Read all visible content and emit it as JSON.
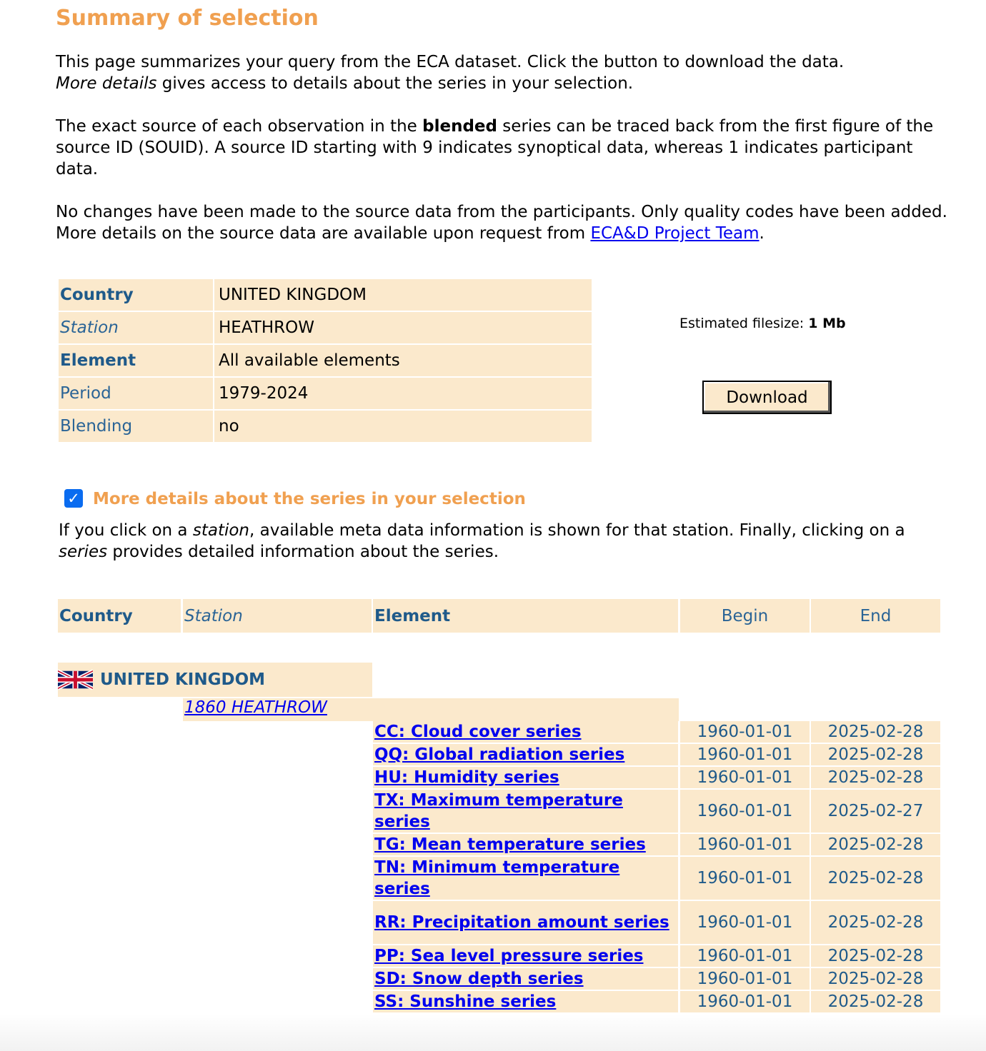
{
  "page": {
    "title": "Summary of selection"
  },
  "intro": {
    "p1_a": "This page summarizes your query from the ECA dataset. Click the button to download the data.",
    "p1_b_italic": "More details",
    "p1_b_rest": " gives access to details about the series in your selection.",
    "p2_a": "The exact source of each observation in the ",
    "p2_bold": "blended",
    "p2_b": " series can be traced back from the first figure of the source ID (SOUID). A source ID starting with 9 indicates synoptical data, whereas 1 indicates participant data.",
    "p3_a": "No changes have been made to the source data from the participants. Only quality codes have been added. More details on the source data are available upon request from ",
    "p3_link": "ECA&D Project Team",
    "p3_end": "."
  },
  "summary": {
    "rows": [
      {
        "key": "Country",
        "value": "UNITED KINGDOM"
      },
      {
        "key": "Station",
        "value": "HEATHROW"
      },
      {
        "key": "Element",
        "value": "All available elements"
      },
      {
        "key": "Period",
        "value": "1979-2024"
      },
      {
        "key": "Blending",
        "value": "no"
      }
    ],
    "filesize_label": "Estimated filesize: ",
    "filesize_value": "1 Mb",
    "download_label": "Download"
  },
  "details": {
    "checked": true,
    "checkbox_label": "More details about the series in your selection",
    "help_a": "If you click on a ",
    "help_station": "station",
    "help_b": ", available meta data information is shown for that station. Finally, clicking on a ",
    "help_series": "series",
    "help_c": " provides detailed information about the series."
  },
  "series_table": {
    "headers": {
      "country": "Country",
      "station": "Station",
      "element": "Element",
      "begin": "Begin",
      "end": "End"
    },
    "country": "UNITED KINGDOM",
    "station": "1860 HEATHROW",
    "rows": [
      {
        "element": "CC: Cloud cover series",
        "begin": "1960-01-01",
        "end": "2025-02-28"
      },
      {
        "element": "QQ: Global radiation series",
        "begin": "1960-01-01",
        "end": "2025-02-28"
      },
      {
        "element": "HU: Humidity series",
        "begin": "1960-01-01",
        "end": "2025-02-28"
      },
      {
        "element": "TX: Maximum temperature series",
        "begin": "1960-01-01",
        "end": "2025-02-27"
      },
      {
        "element": "TG: Mean temperature series",
        "begin": "1960-01-01",
        "end": "2025-02-28"
      },
      {
        "element": "TN: Minimum temperature series",
        "begin": "1960-01-01",
        "end": "2025-02-28"
      },
      {
        "element": "RR: Precipitation amount series",
        "begin": "1960-01-01",
        "end": "2025-02-28"
      },
      {
        "element": "PP: Sea level pressure series",
        "begin": "1960-01-01",
        "end": "2025-02-28"
      },
      {
        "element": "SD: Snow depth series",
        "begin": "1960-01-01",
        "end": "2025-02-28"
      },
      {
        "element": "SS: Sunshine series",
        "begin": "1960-01-01",
        "end": "2025-02-28"
      }
    ]
  },
  "colors": {
    "accent_orange": "#f0a050",
    "table_bg": "#fbe9cc",
    "header_blue": "#1f5a8a",
    "link_blue": "#0000ee"
  }
}
